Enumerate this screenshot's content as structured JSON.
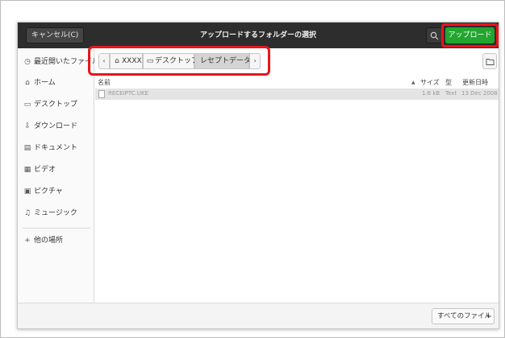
{
  "dialog": {
    "title": "アップロードするフォルダーの選択",
    "cancel_label": "キャンセル(C)",
    "upload_label": "アップロード",
    "search_icon": "search-icon"
  },
  "sidebar": {
    "items": [
      {
        "label": "最近開いたファイル",
        "icon": "clock-icon",
        "glyph": "◷"
      },
      {
        "label": "ホーム",
        "icon": "home-icon",
        "glyph": "⌂"
      },
      {
        "label": "デスクトップ",
        "icon": "desktop-icon",
        "glyph": "▭"
      },
      {
        "label": "ダウンロード",
        "icon": "download-icon",
        "glyph": "⇩"
      },
      {
        "label": "ドキュメント",
        "icon": "document-icon",
        "glyph": "▤"
      },
      {
        "label": "ビデオ",
        "icon": "video-icon",
        "glyph": "▦"
      },
      {
        "label": "ピクチャ",
        "icon": "picture-icon",
        "glyph": "▣"
      },
      {
        "label": "ミュージック",
        "icon": "music-icon",
        "glyph": "♫"
      },
      {
        "label": "他の場所",
        "icon": "plus-icon",
        "glyph": "+"
      }
    ]
  },
  "pathbar": {
    "prev_glyph": "‹",
    "next_glyph": "›",
    "crumbs": [
      {
        "label": "XXXX",
        "icon": "home-icon",
        "glyph": "⌂"
      },
      {
        "label": "デスクトップ",
        "icon": "desktop-icon",
        "glyph": "▭"
      },
      {
        "label": "レセプトデータ",
        "active": true
      }
    ]
  },
  "list": {
    "columns": {
      "name": "名前",
      "size": "サイズ",
      "type": "型",
      "modified": "更新日時",
      "sort_indicator": "▲"
    },
    "files": [
      {
        "name": "RECEIPTC.UKE",
        "size": "1.6 kB",
        "type": "Text",
        "modified": "13 Dec 2008"
      }
    ]
  },
  "footer": {
    "filter_label": "すべてのファイル",
    "filter_caret": "▾"
  },
  "colors": {
    "header_bg": "#2d2d2d",
    "upload_button": "#22a62e",
    "highlight_box": "#e8151b"
  }
}
